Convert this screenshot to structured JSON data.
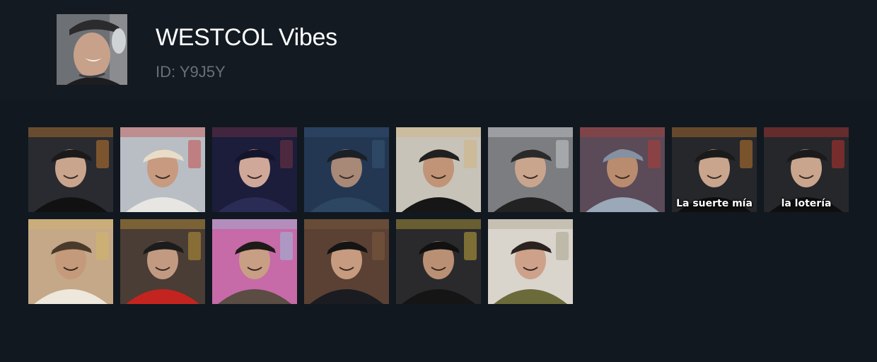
{
  "channel": {
    "title": "WESTCOL Vibes",
    "id_label": "ID: Y9J5Y",
    "avatar_icon": "avatar-photo"
  },
  "stickers": [
    {
      "name": "sticker-1",
      "caption": "",
      "bg": "#2a2b30",
      "shirt": "#111111",
      "hat": "#1a1a1a",
      "skin": "#c9a58d",
      "accent": "#e08a2e"
    },
    {
      "name": "sticker-2",
      "caption": "",
      "bg": "#b9bec4",
      "shirt": "#e7e6e2",
      "hat": "#e8ddc8",
      "skin": "#c89a80",
      "accent": "#c7342e"
    },
    {
      "name": "sticker-3",
      "caption": "",
      "bg": "#1b1d3a",
      "shirt": "#2a2c55",
      "hat": "#14152b",
      "skin": "#cfa89a",
      "accent": "#8b3a4a"
    },
    {
      "name": "sticker-4",
      "caption": "",
      "bg": "#233752",
      "shirt": "#2d4763",
      "hat": "#1b1f26",
      "skin": "#a88876",
      "accent": "#3a5a7a"
    },
    {
      "name": "sticker-5",
      "caption": "",
      "bg": "#c8c3b8",
      "shirt": "#161616",
      "hat": "#202020",
      "skin": "#c19477",
      "accent": "#d0b070"
    },
    {
      "name": "sticker-6",
      "caption": "",
      "bg": "#7b7d80",
      "shirt": "#222222",
      "hat": "#2a2a2a",
      "skin": "#c9a58d",
      "accent": "#d9dde0"
    },
    {
      "name": "sticker-7",
      "caption": "",
      "bg": "#5b4a57",
      "shirt": "#9aa8b8",
      "hat": "#8391a2",
      "skin": "#b98b6f",
      "accent": "#c4392e"
    },
    {
      "name": "sticker-8",
      "caption": "La suerte mía",
      "bg": "#26272b",
      "shirt": "#0f0f10",
      "hat": "#1a1a1a",
      "skin": "#c9a58d",
      "accent": "#e08a2e"
    },
    {
      "name": "sticker-9",
      "caption": "la lotería",
      "bg": "#26272b",
      "shirt": "#0f0f10",
      "hat": "#1a1a1a",
      "skin": "#c9a58d",
      "accent": "#d9362e"
    },
    {
      "name": "sticker-10",
      "caption": "",
      "bg": "#c4a888",
      "shirt": "#ede7dc",
      "hat": "#4a3a2c",
      "skin": "#c49a7a",
      "accent": "#d8b860"
    },
    {
      "name": "sticker-11",
      "caption": "",
      "bg": "#4a3d35",
      "shirt": "#c4241f",
      "hat": "#1c1c1c",
      "skin": "#c29a82",
      "accent": "#d4a838"
    },
    {
      "name": "sticker-12",
      "caption": "",
      "bg": "#c66aa8",
      "shirt": "#5b4c44",
      "hat": "#1d1a18",
      "skin": "#c89e85",
      "accent": "#8fd0e6"
    },
    {
      "name": "sticker-13",
      "caption": "",
      "bg": "#5b4133",
      "shirt": "#1a1c22",
      "hat": "#141414",
      "skin": "#c79b7f",
      "accent": "#806040"
    },
    {
      "name": "sticker-14",
      "caption": "",
      "bg": "#2a2a2c",
      "shirt": "#151516",
      "hat": "#111111",
      "skin": "#ba9075",
      "accent": "#e0c040"
    },
    {
      "name": "sticker-15",
      "caption": "",
      "bg": "#d9d4cc",
      "shirt": "#6b6a3a",
      "hat": "#2a2320",
      "skin": "#cda18a",
      "accent": "#a09a80"
    }
  ]
}
